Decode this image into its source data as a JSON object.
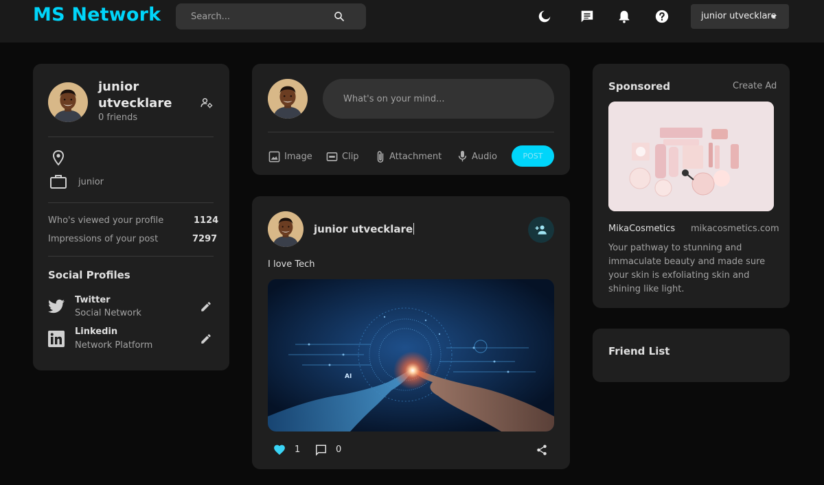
{
  "app": {
    "title": "MS Network"
  },
  "navbar": {
    "search_placeholder": "Search...",
    "icons": [
      "moon-icon",
      "message-icon",
      "bell-icon",
      "help-icon",
      "search-icon"
    ],
    "user_name": "junior utvecklare"
  },
  "profile": {
    "name": "junior utvecklare",
    "friends": "0 friends",
    "location": "",
    "occupation": "junior",
    "stats": [
      {
        "label": "Who's viewed your profile",
        "value": "1124"
      },
      {
        "label": "Impressions of your post",
        "value": "7297"
      }
    ],
    "social_title": "Social Profiles",
    "socials": [
      {
        "name": "Twitter",
        "sub": "Social Network"
      },
      {
        "name": "Linkedin",
        "sub": "Network Platform"
      }
    ]
  },
  "composer": {
    "placeholder": "What's on your mind...",
    "tools": [
      {
        "label": "Image",
        "icon": "image-icon"
      },
      {
        "label": "Clip",
        "icon": "gif-icon"
      },
      {
        "label": "Attachment",
        "icon": "attachment-icon"
      },
      {
        "label": "Audio",
        "icon": "mic-icon"
      }
    ],
    "post_label": "POST"
  },
  "feed": {
    "posts": [
      {
        "author": "junior utvecklare",
        "text": "I love Tech",
        "image_label": "AI",
        "likes": "1",
        "comments": "0"
      }
    ]
  },
  "sponsored": {
    "title": "Sponsored",
    "create_ad": "Create Ad",
    "brand": "MikaCosmetics",
    "url": "mikacosmetics.com",
    "description": "Your pathway to stunning and immaculate beauty and made sure your skin is exfoliating skin and shining like light."
  },
  "friend_list": {
    "title": "Friend List"
  },
  "colors": {
    "accent": "#00d5fa",
    "background": "#0a0a0a",
    "card": "#1f1f1f",
    "navbar": "#1a1a1a"
  }
}
